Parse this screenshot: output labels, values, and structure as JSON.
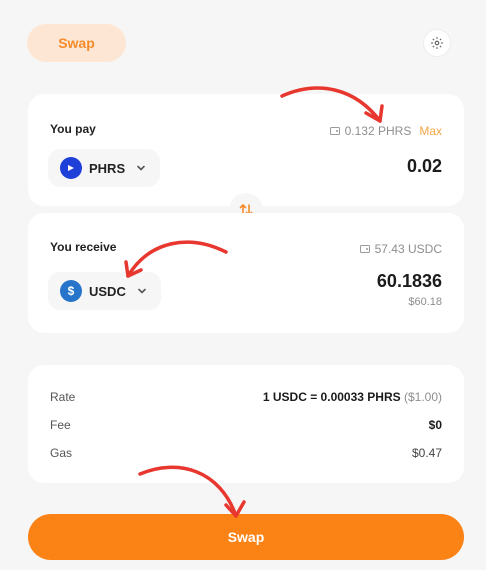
{
  "header": {
    "tab_label": "Swap",
    "settings_icon": "gear-icon"
  },
  "pay": {
    "label": "You pay",
    "balance": "0.132 PHRS",
    "max_label": "Max",
    "token": "PHRS",
    "amount": "0.02"
  },
  "receive": {
    "label": "You receive",
    "balance": "57.43 USDC",
    "token": "USDC",
    "amount": "60.1836",
    "amount_usd": "$60.18"
  },
  "info": {
    "rate_label": "Rate",
    "rate_value": "1 USDC = 0.00033 PHRS",
    "rate_usd": "($1.00)",
    "fee_label": "Fee",
    "fee_value": "$0",
    "gas_label": "Gas",
    "gas_value": "$0.47"
  },
  "action": {
    "swap_label": "Swap"
  },
  "colors": {
    "accent": "#fb8214",
    "annotation": "#e8372f"
  }
}
